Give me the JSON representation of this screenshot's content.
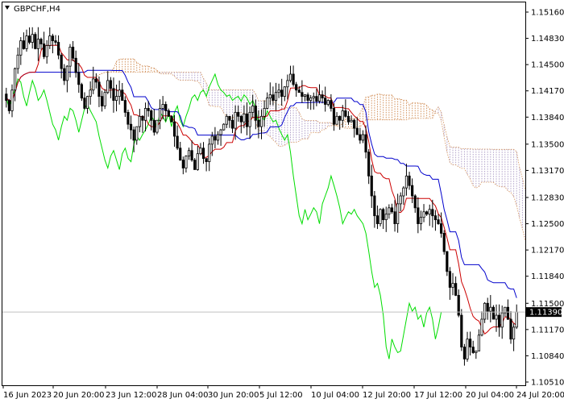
{
  "chart_data": {
    "type": "candlestick",
    "symbol_label": "GBPCHF,H4",
    "grid": false,
    "ylim": [
      1.1051,
      1.1516
    ],
    "y_ticks": [
      "1.15160",
      "1.14830",
      "1.14500",
      "1.14170",
      "1.13840",
      "1.13500",
      "1.13170",
      "1.12830",
      "1.12500",
      "1.12170",
      "1.11840",
      "1.11500",
      "1.11170",
      "1.10840",
      "1.10510"
    ],
    "y_tick_values": [
      1.1516,
      1.1483,
      1.145,
      1.1417,
      1.1384,
      1.135,
      1.1317,
      1.1283,
      1.125,
      1.1217,
      1.1184,
      1.115,
      1.1117,
      1.1084,
      1.1051
    ],
    "x_ticks": [
      "16 Jun 2023",
      "20 Jun 20:00",
      "23 Jun 12:00",
      "28 Jun 04:00",
      "30 Jun 20:00",
      "5 Jul 12:00",
      "10 Jul 04:00",
      "12 Jul 20:00",
      "17 Jul 12:00",
      "20 Jul 04:00",
      "24 Jul 20:00"
    ],
    "current_price": "1.11390",
    "current_price_value": 1.1139,
    "colors": {
      "background": "#ffffff",
      "candle": "#000000",
      "tenkan_sen": "#cc0000",
      "kijun_sen": "#0000cc",
      "chikou_span": "#00dd00",
      "kumo": "#d2905a",
      "kumo_alt": "#b0a0c8",
      "price_line": "#c0c0c0",
      "price_label_bg": "#000000"
    },
    "indicators": [
      "Tenkan-sen",
      "Kijun-sen",
      "Chikou Span",
      "Senkou Span A",
      "Senkou Span B"
    ],
    "closes": [
      1.1405,
      1.1392,
      1.1418,
      1.1445,
      1.1462,
      1.148,
      1.147,
      1.1486,
      1.1478,
      1.1488,
      1.147,
      1.1482,
      1.1476,
      1.146,
      1.1474,
      1.1486,
      1.148,
      1.1478,
      1.1462,
      1.1445,
      1.143,
      1.1448,
      1.1472,
      1.1458,
      1.144,
      1.1425,
      1.1408,
      1.1395,
      1.141,
      1.1418,
      1.1432,
      1.1428,
      1.141,
      1.1398,
      1.1415,
      1.143,
      1.142,
      1.1405,
      1.141,
      1.1418,
      1.1405,
      1.139,
      1.1375,
      1.1368,
      1.1355,
      1.1372,
      1.1385,
      1.138,
      1.1395,
      1.1392,
      1.138,
      1.1365,
      1.138,
      1.1395,
      1.14,
      1.1392,
      1.1385,
      1.1378,
      1.136,
      1.1345,
      1.133,
      1.132,
      1.1335,
      1.1342,
      1.133,
      1.1318,
      1.1338,
      1.1345,
      1.1332,
      1.1328,
      1.135,
      1.136,
      1.1355,
      1.1362,
      1.1368,
      1.1375,
      1.1385,
      1.138,
      1.137,
      1.139,
      1.1385,
      1.1378,
      1.1388,
      1.1372,
      1.139,
      1.1398,
      1.138,
      1.1372,
      1.1385,
      1.1395,
      1.1408,
      1.1412,
      1.1405,
      1.1415,
      1.1418,
      1.141,
      1.1422,
      1.143,
      1.1438,
      1.1425,
      1.1418,
      1.1415,
      1.141,
      1.1412,
      1.1405,
      1.1408,
      1.141,
      1.1404,
      1.1412,
      1.1408,
      1.14,
      1.1405,
      1.1395,
      1.1375,
      1.1385,
      1.138,
      1.1392,
      1.1385,
      1.1378,
      1.138,
      1.137,
      1.1362,
      1.1355,
      1.1362,
      1.134,
      1.131,
      1.1285,
      1.126,
      1.125,
      1.1268,
      1.1255,
      1.1262,
      1.127,
      1.1265,
      1.125,
      1.1275,
      1.1285,
      1.1295,
      1.131,
      1.1298,
      1.1285,
      1.127,
      1.125,
      1.1258,
      1.1265,
      1.1262,
      1.1268,
      1.126,
      1.1255,
      1.125,
      1.1238,
      1.1215,
      1.119,
      1.117,
      1.1175,
      1.116,
      1.1135,
      1.1095,
      1.108,
      1.1105,
      1.1095,
      1.1088,
      1.109,
      1.111,
      1.113,
      1.115,
      1.114,
      1.1145,
      1.113,
      1.1135,
      1.112,
      1.1138,
      1.1145,
      1.113,
      1.1105,
      1.112,
      1.1139
    ]
  }
}
